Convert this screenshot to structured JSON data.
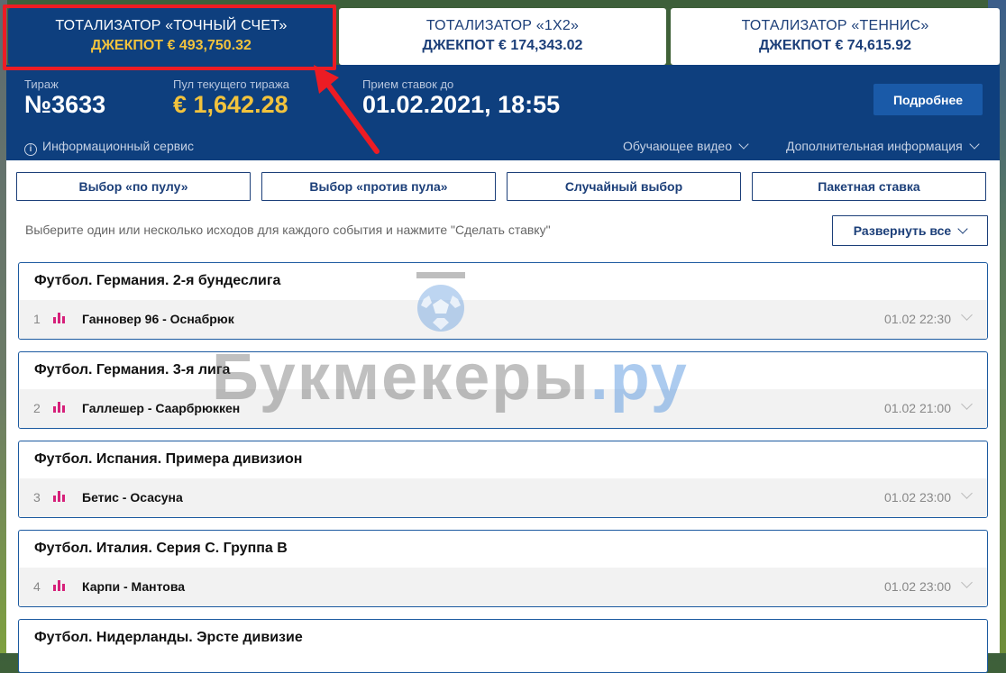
{
  "tabs": [
    {
      "title": "ТОТАЛИЗАТОР «ТОЧНЫЙ СЧЕТ»",
      "jackpot": "ДЖЕКПОТ € 493,750.32",
      "active": true
    },
    {
      "title": "ТОТАЛИЗАТОР «1Х2»",
      "jackpot": "ДЖЕКПОТ € 174,343.02",
      "active": false
    },
    {
      "title": "ТОТАЛИЗАТОР «ТЕННИС»",
      "jackpot": "ДЖЕКПОТ € 74,615.92",
      "active": false
    }
  ],
  "draw": {
    "label": "Тираж",
    "number": "№3633",
    "pool_label": "Пул текущего тиража",
    "pool": "€ 1,642.28",
    "deadline_label": "Прием ставок до",
    "deadline": "01.02.2021, 18:55",
    "more_button": "Подробнее"
  },
  "links": {
    "info_service": "Информационный сервис",
    "tutorial_video": "Обучающее видео",
    "additional_info": "Дополнительная информация"
  },
  "modes": [
    "Выбор «по пулу»",
    "Выбор «против пула»",
    "Случайный выбор",
    "Пакетная ставка"
  ],
  "hint": "Выберите один или несколько исходов для каждого события и нажмите \"Сделать ставку\"",
  "expand_all": "Развернуть все",
  "events": [
    {
      "league": "Футбол. Германия. 2-я бундеслига",
      "num": "1",
      "match": "Ганновер 96 - Оснабрюк",
      "date": "01.02 22:30"
    },
    {
      "league": "Футбол. Германия. 3-я лига",
      "num": "2",
      "match": "Галлешер - Саарбрюккен",
      "date": "01.02 21:00"
    },
    {
      "league": "Футбол. Испания. Примера дивизион",
      "num": "3",
      "match": "Бетис - Осасуна",
      "date": "01.02 23:00"
    },
    {
      "league": "Футбол. Италия. Серия С. Группа B",
      "num": "4",
      "match": "Карпи - Мантова",
      "date": "01.02 23:00"
    },
    {
      "league": "Футбол. Нидерланды. Эрсте дивизие"
    }
  ],
  "watermark": {
    "main": "Букмекеры",
    "suffix": ".ру"
  },
  "colors": {
    "brand_blue": "#0e3f7e",
    "gold": "#f2c33d",
    "highlight_red": "#ec1c24",
    "stat_pink": "#d6207a"
  }
}
